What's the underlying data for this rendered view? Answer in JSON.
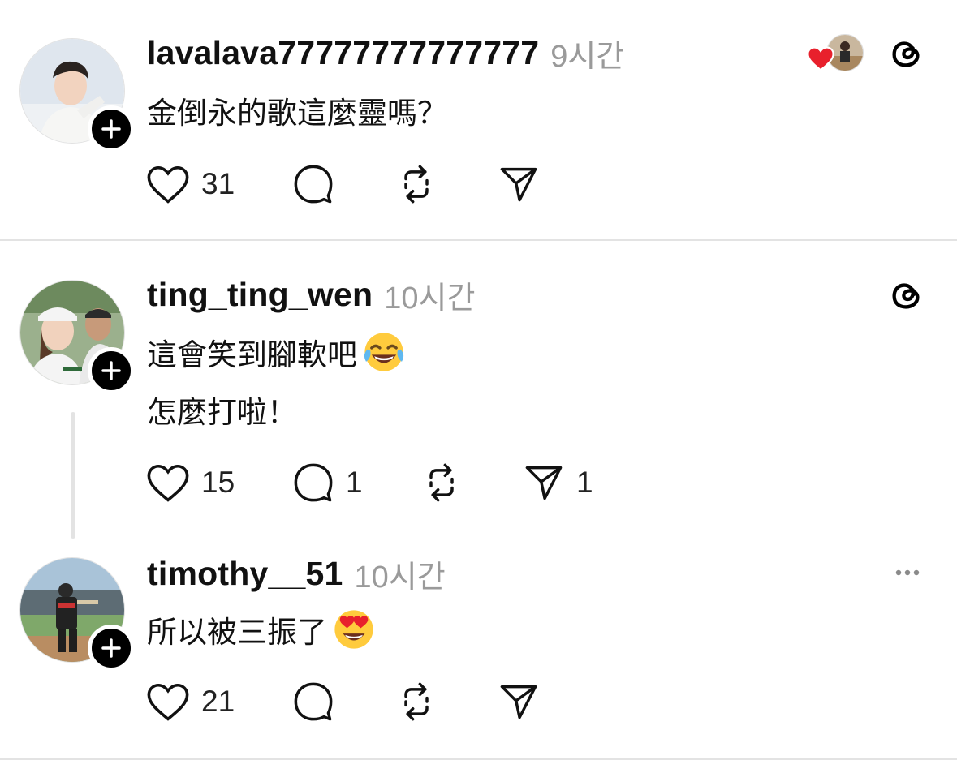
{
  "posts": [
    {
      "username": "lavalava77777777777777",
      "time": "9시간",
      "lines": [
        "金倒永的歌這麼靈嗎？"
      ],
      "likes": "31",
      "replies": "",
      "reposts": "",
      "shares": "",
      "avatar": "avatar-person-white-outfit",
      "liked_by_author_badge": true
    },
    {
      "username": "ting_ting_wen",
      "time": "10시간",
      "lines": [
        "這會笑到腳軟吧",
        "怎麼打啦！"
      ],
      "line_emoji": [
        "face-with-tears-of-joy",
        ""
      ],
      "likes": "15",
      "replies": "1",
      "reposts": "",
      "shares": "1",
      "avatar": "avatar-two-people-stadium"
    },
    {
      "username": "timothy__51",
      "time": "10시간",
      "lines": [
        "所以被三振了"
      ],
      "line_emoji": [
        "heart-eyes-face"
      ],
      "likes": "21",
      "replies": "",
      "reposts": "",
      "shares": "",
      "avatar": "avatar-player-field"
    }
  ],
  "colors": {
    "heart_red": "#e8202c",
    "username": "#111111",
    "timestamp": "#9a9a9a",
    "divider": "#e3e3e3"
  },
  "icons": [
    "heart-icon",
    "comment-icon",
    "repost-icon",
    "share-icon",
    "threads-logo-icon",
    "more-icon",
    "plus-icon"
  ]
}
